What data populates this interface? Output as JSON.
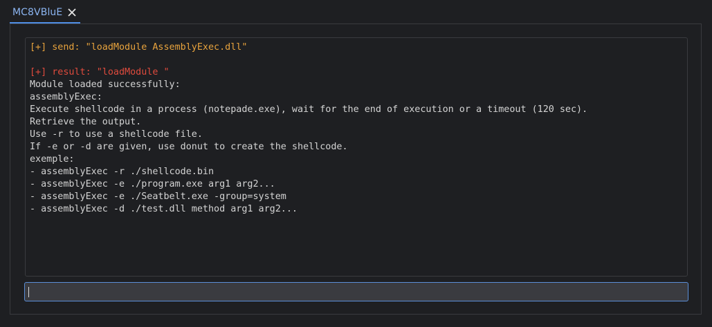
{
  "tab": {
    "label": "MC8VBluE"
  },
  "console": {
    "lines": [
      {
        "text": "[+] send: \"loadModule AssemblyExec.dll\"",
        "kind": "send"
      },
      {
        "text": "",
        "kind": "plain"
      },
      {
        "text": "[+] result: \"loadModule \"",
        "kind": "result"
      },
      {
        "text": "Module loaded successfully:",
        "kind": "plain"
      },
      {
        "text": "assemblyExec:",
        "kind": "plain"
      },
      {
        "text": "Execute shellcode in a process (notepade.exe), wait for the end of execution or a timeout (120 sec).",
        "kind": "plain"
      },
      {
        "text": "Retrieve the output.",
        "kind": "plain"
      },
      {
        "text": "Use -r to use a shellcode file.",
        "kind": "plain"
      },
      {
        "text": "If -e or -d are given, use donut to create the shellcode.",
        "kind": "plain"
      },
      {
        "text": "exemple:",
        "kind": "plain"
      },
      {
        "text": "- assemblyExec -r ./shellcode.bin",
        "kind": "plain"
      },
      {
        "text": "- assemblyExec -e ./program.exe arg1 arg2...",
        "kind": "plain"
      },
      {
        "text": "- assemblyExec -e ./Seatbelt.exe -group=system",
        "kind": "plain"
      },
      {
        "text": "- assemblyExec -d ./test.dll method arg1 arg2...",
        "kind": "plain"
      }
    ]
  },
  "command_input": {
    "value": ""
  }
}
